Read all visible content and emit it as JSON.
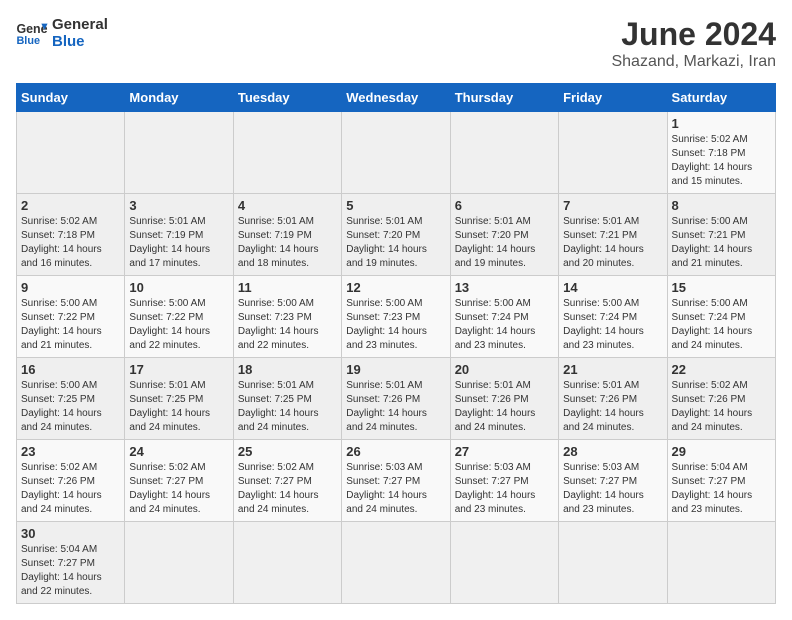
{
  "header": {
    "logo_general": "General",
    "logo_blue": "Blue",
    "title": "June 2024",
    "subtitle": "Shazand, Markazi, Iran"
  },
  "weekdays": [
    "Sunday",
    "Monday",
    "Tuesday",
    "Wednesday",
    "Thursday",
    "Friday",
    "Saturday"
  ],
  "weeks": [
    [
      {
        "day": "",
        "info": ""
      },
      {
        "day": "",
        "info": ""
      },
      {
        "day": "",
        "info": ""
      },
      {
        "day": "",
        "info": ""
      },
      {
        "day": "",
        "info": ""
      },
      {
        "day": "",
        "info": ""
      },
      {
        "day": "1",
        "info": "Sunrise: 5:02 AM\nSunset: 7:18 PM\nDaylight: 14 hours and 15 minutes."
      }
    ],
    [
      {
        "day": "2",
        "info": "Sunrise: 5:02 AM\nSunset: 7:18 PM\nDaylight: 14 hours and 16 minutes."
      },
      {
        "day": "3",
        "info": "Sunrise: 5:01 AM\nSunset: 7:19 PM\nDaylight: 14 hours and 17 minutes."
      },
      {
        "day": "4",
        "info": "Sunrise: 5:01 AM\nSunset: 7:19 PM\nDaylight: 14 hours and 18 minutes."
      },
      {
        "day": "5",
        "info": "Sunrise: 5:01 AM\nSunset: 7:20 PM\nDaylight: 14 hours and 19 minutes."
      },
      {
        "day": "6",
        "info": "Sunrise: 5:01 AM\nSunset: 7:20 PM\nDaylight: 14 hours and 19 minutes."
      },
      {
        "day": "7",
        "info": "Sunrise: 5:01 AM\nSunset: 7:21 PM\nDaylight: 14 hours and 20 minutes."
      },
      {
        "day": "8",
        "info": "Sunrise: 5:00 AM\nSunset: 7:21 PM\nDaylight: 14 hours and 21 minutes."
      }
    ],
    [
      {
        "day": "9",
        "info": "Sunrise: 5:00 AM\nSunset: 7:22 PM\nDaylight: 14 hours and 21 minutes."
      },
      {
        "day": "10",
        "info": "Sunrise: 5:00 AM\nSunset: 7:22 PM\nDaylight: 14 hours and 22 minutes."
      },
      {
        "day": "11",
        "info": "Sunrise: 5:00 AM\nSunset: 7:23 PM\nDaylight: 14 hours and 22 minutes."
      },
      {
        "day": "12",
        "info": "Sunrise: 5:00 AM\nSunset: 7:23 PM\nDaylight: 14 hours and 23 minutes."
      },
      {
        "day": "13",
        "info": "Sunrise: 5:00 AM\nSunset: 7:24 PM\nDaylight: 14 hours and 23 minutes."
      },
      {
        "day": "14",
        "info": "Sunrise: 5:00 AM\nSunset: 7:24 PM\nDaylight: 14 hours and 23 minutes."
      },
      {
        "day": "15",
        "info": "Sunrise: 5:00 AM\nSunset: 7:24 PM\nDaylight: 14 hours and 24 minutes."
      }
    ],
    [
      {
        "day": "16",
        "info": "Sunrise: 5:00 AM\nSunset: 7:25 PM\nDaylight: 14 hours and 24 minutes."
      },
      {
        "day": "17",
        "info": "Sunrise: 5:01 AM\nSunset: 7:25 PM\nDaylight: 14 hours and 24 minutes."
      },
      {
        "day": "18",
        "info": "Sunrise: 5:01 AM\nSunset: 7:25 PM\nDaylight: 14 hours and 24 minutes."
      },
      {
        "day": "19",
        "info": "Sunrise: 5:01 AM\nSunset: 7:26 PM\nDaylight: 14 hours and 24 minutes."
      },
      {
        "day": "20",
        "info": "Sunrise: 5:01 AM\nSunset: 7:26 PM\nDaylight: 14 hours and 24 minutes."
      },
      {
        "day": "21",
        "info": "Sunrise: 5:01 AM\nSunset: 7:26 PM\nDaylight: 14 hours and 24 minutes."
      },
      {
        "day": "22",
        "info": "Sunrise: 5:02 AM\nSunset: 7:26 PM\nDaylight: 14 hours and 24 minutes."
      }
    ],
    [
      {
        "day": "23",
        "info": "Sunrise: 5:02 AM\nSunset: 7:26 PM\nDaylight: 14 hours and 24 minutes."
      },
      {
        "day": "24",
        "info": "Sunrise: 5:02 AM\nSunset: 7:27 PM\nDaylight: 14 hours and 24 minutes."
      },
      {
        "day": "25",
        "info": "Sunrise: 5:02 AM\nSunset: 7:27 PM\nDaylight: 14 hours and 24 minutes."
      },
      {
        "day": "26",
        "info": "Sunrise: 5:03 AM\nSunset: 7:27 PM\nDaylight: 14 hours and 24 minutes."
      },
      {
        "day": "27",
        "info": "Sunrise: 5:03 AM\nSunset: 7:27 PM\nDaylight: 14 hours and 23 minutes."
      },
      {
        "day": "28",
        "info": "Sunrise: 5:03 AM\nSunset: 7:27 PM\nDaylight: 14 hours and 23 minutes."
      },
      {
        "day": "29",
        "info": "Sunrise: 5:04 AM\nSunset: 7:27 PM\nDaylight: 14 hours and 23 minutes."
      }
    ],
    [
      {
        "day": "30",
        "info": "Sunrise: 5:04 AM\nSunset: 7:27 PM\nDaylight: 14 hours and 22 minutes."
      },
      {
        "day": "",
        "info": ""
      },
      {
        "day": "",
        "info": ""
      },
      {
        "day": "",
        "info": ""
      },
      {
        "day": "",
        "info": ""
      },
      {
        "day": "",
        "info": ""
      },
      {
        "day": "",
        "info": ""
      }
    ]
  ]
}
